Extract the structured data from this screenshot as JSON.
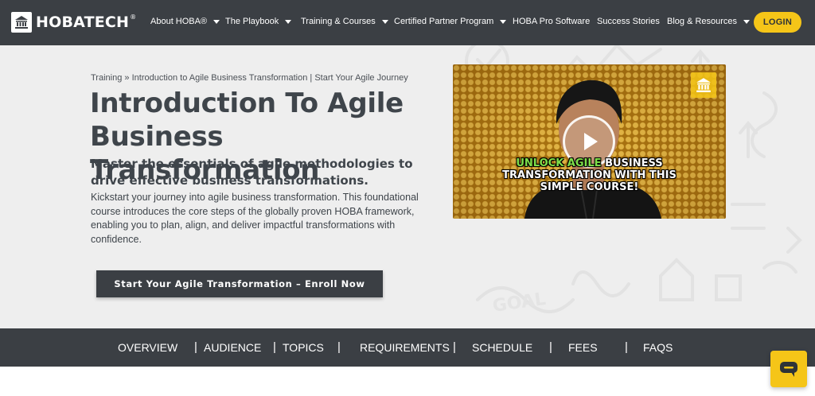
{
  "header": {
    "logo_text": "HOBATECH",
    "logo_mark": "®",
    "nav": [
      {
        "label": "About HOBA®",
        "dropdown": true
      },
      {
        "label": "The Playbook",
        "dropdown": true
      },
      {
        "label": "Training & Courses",
        "dropdown": true
      },
      {
        "label": "Certified Partner Program",
        "dropdown": true
      },
      {
        "label": "HOBA Pro Software",
        "dropdown": false
      },
      {
        "label": "Success Stories",
        "dropdown": false
      },
      {
        "label": "Blog & Resources",
        "dropdown": true
      }
    ],
    "login_label": "LOGIN"
  },
  "breadcrumb": {
    "root": "Training",
    "separator": "»",
    "parent": "Introduction to Agile Business Transformation",
    "divider": "|",
    "current": "Start Your Agile Journey"
  },
  "hero": {
    "title": "Introduction To Agile Business Transformation",
    "subtitle": "Master the essentials of agile methodologies to drive effective business transformations.",
    "description": "Kickstart your journey into agile business transformation. This foundational course introduces the core steps of the globally proven HOBA framework, enabling you to plan, align, and deliver impactful transformations with confidence.",
    "cta_label": "Start Your Agile Transformation – Enroll Now"
  },
  "video": {
    "caption_highlight": "UNLOCK AGILE",
    "caption_line1_rest": " BUSINESS",
    "caption_line2": "TRANSFORMATION WITH THIS",
    "caption_line3": "SIMPLE COURSE!"
  },
  "section_tabs": [
    {
      "label": "OVERVIEW"
    },
    {
      "label": "AUDIENCE"
    },
    {
      "label": "TOPICS"
    },
    {
      "label": "REQUIREMENTS"
    },
    {
      "label": "SCHEDULE"
    },
    {
      "label": "FEES"
    },
    {
      "label": "FAQS"
    }
  ],
  "tab_separator": "|",
  "colors": {
    "nav_bg": "#3b3f44",
    "accent": "#f5c518",
    "hero_bg": "#eeeeee",
    "text_dark": "#3f454b",
    "caption_highlight": "#7ee04a"
  },
  "icons": {
    "logo": "bank-icon",
    "play": "play-icon",
    "chat": "chat-bubble-icon",
    "dropdown": "caret-down-icon"
  }
}
